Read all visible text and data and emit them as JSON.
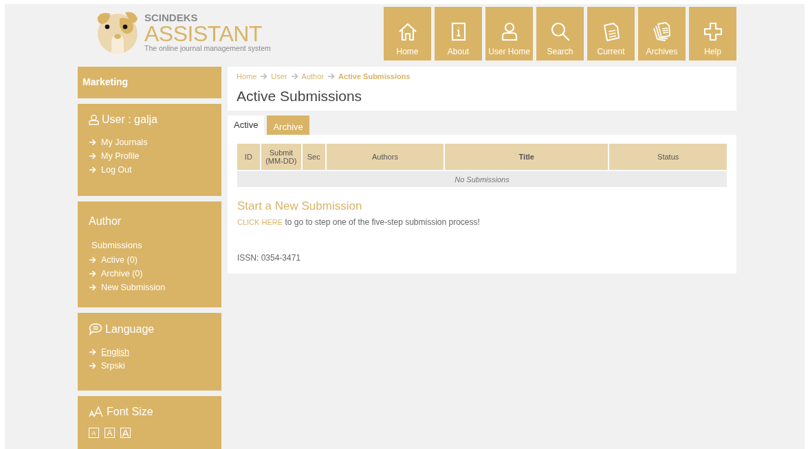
{
  "logo": {
    "brand": "SCINDEKS",
    "name": "ASSISTANT",
    "tagline": "The online journal management system"
  },
  "nav": [
    {
      "kind": "home",
      "label": "Home"
    },
    {
      "kind": "about",
      "label": "About"
    },
    {
      "kind": "user",
      "label": "User Home"
    },
    {
      "kind": "search",
      "label": "Search"
    },
    {
      "kind": "current",
      "label": "Current"
    },
    {
      "kind": "archives",
      "label": "Archives"
    },
    {
      "kind": "help",
      "label": "Help"
    }
  ],
  "sidebar": {
    "marketing": {
      "title": "Marketing"
    },
    "user": {
      "title": "User : galja",
      "links": [
        "My Journals",
        "My Profile",
        "Log Out"
      ]
    },
    "author": {
      "title": "Author",
      "subtitle": "Submissions",
      "links": [
        "Active (0)",
        "Archive (0)",
        "New Submission"
      ]
    },
    "language": {
      "title": "Language",
      "options": [
        {
          "label": "English",
          "selected": true
        },
        {
          "label": "Srpski",
          "selected": false
        }
      ]
    },
    "font_size": {
      "title": "Font Size",
      "options": [
        "A",
        "A",
        "A"
      ]
    }
  },
  "breadcrumb": [
    "Home",
    "User",
    "Author",
    "Active Submissions"
  ],
  "page_title": "Active Submissions",
  "tabs": [
    {
      "label": "Active",
      "selected": true
    },
    {
      "label": "Archive",
      "selected": false
    }
  ],
  "table": {
    "columns": [
      {
        "label": "ID",
        "sorted": false
      },
      {
        "label": "Submit\n(MM-DD)",
        "sorted": false
      },
      {
        "label": "Sec",
        "sorted": false
      },
      {
        "label": "Authors",
        "sorted": false
      },
      {
        "label": "Title",
        "sorted": true
      },
      {
        "label": "Status",
        "sorted": false
      }
    ],
    "empty_message": "No Submissions"
  },
  "new_submission": {
    "heading": "Start a New Submission",
    "link": "CLICK HERE",
    "text": "to go to step one of the five-step submission process!"
  },
  "issn": "ISSN: 0354-3471"
}
